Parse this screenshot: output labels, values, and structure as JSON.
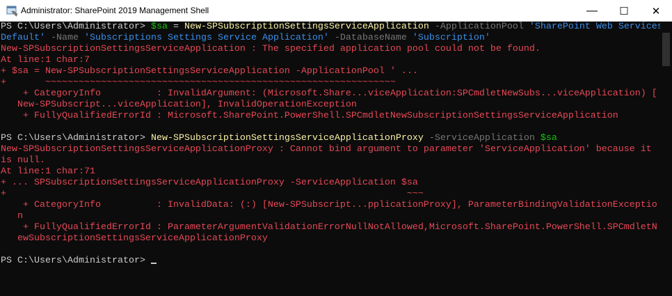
{
  "window": {
    "title": "Administrator: SharePoint 2019 Management Shell",
    "icon": "sharepoint-shell-icon",
    "minimize_glyph": "—",
    "maximize_glyph": "☐",
    "close_glyph": "✕"
  },
  "colors": {
    "background": "#0c0c0c",
    "text": "#cccccc",
    "command": "#f9f1a5",
    "variable": "#16c60c",
    "string": "#3b8eea",
    "parameter": "#767676",
    "error": "#e74856"
  },
  "console": {
    "lines": [
      [
        [
          "gray",
          "PS C:\\Users\\Administrator> "
        ],
        [
          "green",
          "$sa"
        ],
        [
          "gray",
          " = "
        ],
        [
          "yellow",
          "New-SPSubscriptionSettingsServiceApplication"
        ],
        [
          "dim",
          " -ApplicationPool "
        ],
        [
          "blue",
          "'SharePoint Web Services"
        ]
      ],
      [
        [
          "blue",
          "Default'"
        ],
        [
          "dim",
          " -Name "
        ],
        [
          "blue",
          "'Subscriptions Settings Service Application'"
        ],
        [
          "dim",
          " -DatabaseName "
        ],
        [
          "blue",
          "'Subscription'"
        ]
      ],
      [
        [
          "red",
          "New-SPSubscriptionSettingsServiceApplication : The specified application pool could not be found."
        ]
      ],
      [
        [
          "red",
          "At line:1 char:7"
        ]
      ],
      [
        [
          "red",
          "+ $sa = New-SPSubscriptionSettingsServiceApplication -ApplicationPool ' ..."
        ]
      ],
      [
        [
          "red",
          "+       ~~~~~~~~~~~~~~~~~~~~~~~~~~~~~~~~~~~~~~~~~~~~~~~~~~~~~~~~~~~~~~~"
        ]
      ],
      [
        [
          "red",
          "    + CategoryInfo          : InvalidArgument: (Microsoft.Share...viceApplication:SPCmdletNewSubs...viceApplication) ["
        ]
      ],
      [
        [
          "red",
          "   New-SPSubscript...viceApplication], InvalidOperationException"
        ]
      ],
      [
        [
          "red",
          "    + FullyQualifiedErrorId : Microsoft.SharePoint.PowerShell.SPCmdletNewSubscriptionSettingsServiceApplication"
        ]
      ],
      [],
      [
        [
          "gray",
          "PS C:\\Users\\Administrator> "
        ],
        [
          "yellow",
          "New-SPSubscriptionSettingsServiceApplicationProxy"
        ],
        [
          "dim",
          " -ServiceApplication "
        ],
        [
          "green",
          "$sa"
        ]
      ],
      [
        [
          "red",
          "New-SPSubscriptionSettingsServiceApplicationProxy : Cannot bind argument to parameter 'ServiceApplication' because it"
        ]
      ],
      [
        [
          "red",
          "is null."
        ]
      ],
      [
        [
          "red",
          "At line:1 char:71"
        ]
      ],
      [
        [
          "red",
          "+ ... SPSubscriptionSettingsServiceApplicationProxy -ServiceApplication $sa"
        ]
      ],
      [
        [
          "red",
          "+                                                                        ~~~"
        ]
      ],
      [
        [
          "red",
          "    + CategoryInfo          : InvalidData: (:) [New-SPSubscript...pplicationProxy], ParameterBindingValidationExceptio"
        ]
      ],
      [
        [
          "red",
          "   n"
        ]
      ],
      [
        [
          "red",
          "    + FullyQualifiedErrorId : ParameterArgumentValidationErrorNullNotAllowed,Microsoft.SharePoint.PowerShell.SPCmdletN"
        ]
      ],
      [
        [
          "red",
          "   ewSubscriptionSettingsServiceApplicationProxy"
        ]
      ],
      [],
      [
        [
          "gray",
          "PS C:\\Users\\Administrator> "
        ]
      ]
    ]
  }
}
